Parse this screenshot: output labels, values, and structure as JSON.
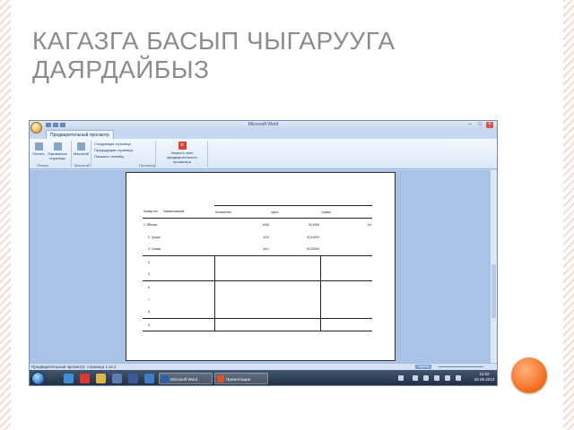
{
  "slide": {
    "title": "КАГАЗГА БАСЫП ЧЫГАРУУГА ДАЯРДАЙБЫЗ"
  },
  "window": {
    "title": "Microsoft Word",
    "controls": [
      "–",
      "□",
      "×"
    ],
    "tab": "Предварительный просмотр"
  },
  "ribbon": {
    "print_label": "Печать",
    "options_label": "Параметры страницы",
    "zoom_label": "Масштаб",
    "menu": [
      "Следующая страница",
      "Предыдущая страница",
      "Показать линейку"
    ],
    "close_label": "Закрыть окно предварительного просмотра",
    "groups": [
      "Печать",
      "Масштаб",
      "Просмотр"
    ]
  },
  "document": {
    "headers": [
      "Номер п/п",
      "Наименование",
      "Количество",
      "Цена",
      "Сумма"
    ],
    "rows": [
      [
        "1. Яблоки",
        "",
        "1/0(5",
        "24,4000",
        "1/4"
      ],
      [
        "2. Груши",
        "",
        "4/10",
        "42,10000",
        ""
      ],
      [
        "3. Сливы",
        "",
        "54/1",
        "54,20000",
        ""
      ],
      [
        "4",
        "",
        "",
        "",
        ""
      ],
      [
        "5",
        "",
        "",
        "",
        ""
      ],
      [
        "6",
        "",
        "",
        "",
        ""
      ],
      [
        "7",
        "",
        "",
        "",
        ""
      ],
      [
        "8",
        "",
        "",
        "",
        ""
      ],
      [
        "9",
        "",
        "",
        "",
        ""
      ]
    ]
  },
  "status": {
    "text": "Предварительный просмотр: страница 1 из 2",
    "zoom_text": "Курсив"
  },
  "taskbar": {
    "tasks": [
      "Microsoft Word",
      "Презентация"
    ],
    "clock_time": "11:02",
    "clock_date": "25.06.2013"
  },
  "colors": {
    "title_gray": "#8c8c8c",
    "accent_orange": "#f26a1b",
    "stripe": "#f4d9cc"
  }
}
